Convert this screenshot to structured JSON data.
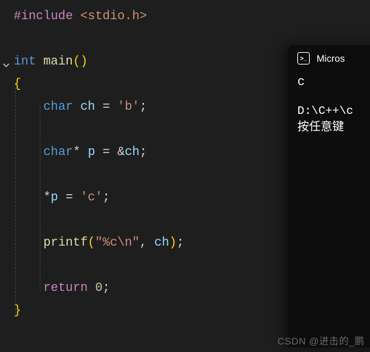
{
  "code": {
    "include": {
      "hash": "#include",
      "header": "<stdio.h>"
    },
    "decl": {
      "ret": "int",
      "name": "main",
      "paren": "()"
    },
    "lbrace": "{",
    "l1": {
      "type": "char",
      "var": "ch",
      "eq": " = ",
      "val": "'b'",
      "semi": ";"
    },
    "l2": {
      "type": "char",
      "star": "*",
      "var": "p",
      "eq": " = ",
      "amp": "&",
      "rhs": "ch",
      "semi": ";"
    },
    "l3": {
      "star": "*",
      "var": "p",
      "eq": " = ",
      "val": "'c'",
      "semi": ";"
    },
    "l4": {
      "fn": "printf",
      "open": "(",
      "str": "\"%c\\n\"",
      "comma": ", ",
      "arg": "ch",
      "close": ")",
      "semi": ";"
    },
    "l5": {
      "kw": "return",
      "sp": " ",
      "val": "0",
      "semi": ";"
    },
    "rbrace": "}"
  },
  "terminal": {
    "title": "Micros",
    "icon_glyph": ">_",
    "output": "c",
    "path": "D:\\C++\\c",
    "prompt": "按任意键"
  },
  "watermark": "CSDN @进击的_鹏"
}
